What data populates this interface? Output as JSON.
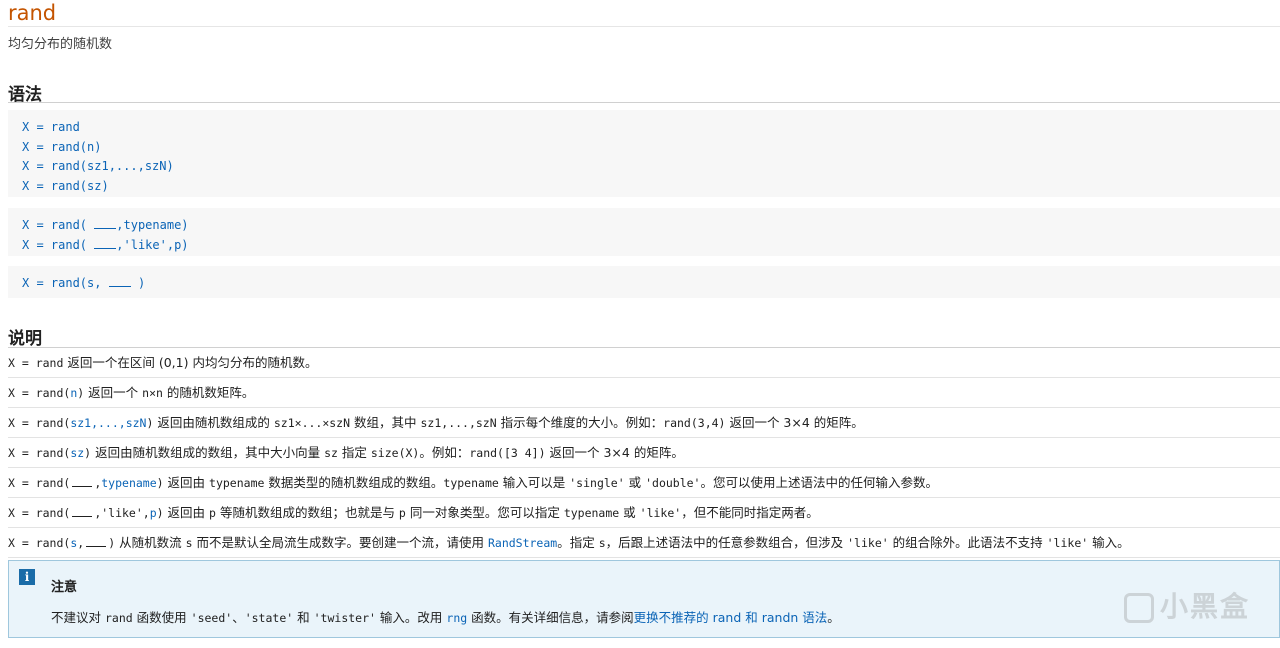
{
  "page": {
    "title": "rand",
    "purpose": "均匀分布的随机数"
  },
  "syntax": {
    "heading": "语法",
    "group1": [
      "X = rand",
      "X = rand(n)",
      "X = rand(sz1,...,szN)",
      "X = rand(sz)"
    ],
    "group2": [
      {
        "pre": "X = rand(",
        "post": ",typename)"
      },
      {
        "pre": "X = rand(",
        "post": ",'like',p)"
      }
    ],
    "group3": {
      "pre": "X = rand(s,",
      "post": ")"
    }
  },
  "description": {
    "heading": "说明",
    "rows": [
      {
        "code": "X = rand",
        "text": " 返回一个在区间 (0,1) 内均匀分布的随机数。"
      },
      {
        "code_pre": "X = rand(",
        "arg": "n",
        "code_post": ")",
        "text": " 返回一个 ",
        "mono1": "n×n",
        "text2": " 的随机数矩阵。"
      },
      {
        "code_pre": "X = rand(",
        "arg": "sz1,...,szN",
        "code_post": ")",
        "text": " 返回由随机数组成的 ",
        "mono1": "sz1×...×szN",
        "text2": " 数组，其中 ",
        "mono2": "sz1,...,szN",
        "text3": " 指示每个维度的大小。例如：",
        "mono3": "rand(3,4)",
        "text4": " 返回一个 3×4 的矩阵。"
      },
      {
        "code_pre": "X = rand(",
        "arg": "sz",
        "code_post": ")",
        "text": " 返回由随机数组成的数组，其中大小向量 ",
        "mono1": "sz",
        "text2": " 指定 ",
        "mono2": "size(X)",
        "text3": "。例如：",
        "mono3": "rand([3 4])",
        "text4": " 返回一个 3×4 的矩阵。"
      },
      {
        "code_pre": "X = rand(",
        "sep": ",",
        "arg": "typename",
        "code_post": ")",
        "text": " 返回由 ",
        "mono1": "typename",
        "text2": " 数据类型的随机数组成的数组。",
        "mono2": "typename",
        "text3": " 输入可以是 ",
        "mono3": "'single'",
        "text4": " 或 ",
        "mono4": "'double'",
        "text5": "。您可以使用上述语法中的任何输入参数。"
      },
      {
        "code_pre": "X = rand(",
        "sep": ",'like',",
        "arg": "p",
        "code_post": ")",
        "text": " 返回由 ",
        "mono1": "p",
        "text2": " 等随机数组成的数组；也就是与 ",
        "mono2": "p",
        "text3": " 同一对象类型。您可以指定 ",
        "mono3": "typename",
        "text4": " 或 ",
        "mono4": "'like'",
        "text5": "，但不能同时指定两者。"
      },
      {
        "code_pre": "X = rand(",
        "arg": "s",
        "sep": ",",
        "code_post": ")",
        "text": " 从随机数流 ",
        "mono1": "s",
        "text2": " 而不是默认全局流生成数字。要创建一个流，请使用 ",
        "link": "RandStream",
        "text3": "。指定 ",
        "mono2": "s",
        "text4": "，后跟上述语法中的任意参数组合，但涉及 ",
        "mono3": "'like'",
        "text5": " 的组合除外。此语法不支持 ",
        "mono4": "'like'",
        "text6": " 输入。"
      }
    ]
  },
  "note": {
    "title": "注意",
    "t1": "不建议对 ",
    "m1": "rand",
    "t2": " 函数使用 ",
    "m2": "'seed'",
    "t3": "、",
    "m3": "'state'",
    "t4": " 和 ",
    "m4": "'twister'",
    "t5": " 输入。改用 ",
    "link1": "rng",
    "t6": " 函数。有关详细信息，请参阅",
    "link2": "更换不推荐的 rand 和 randn 语法",
    "t7": "。"
  },
  "watermark": "小黑盒"
}
